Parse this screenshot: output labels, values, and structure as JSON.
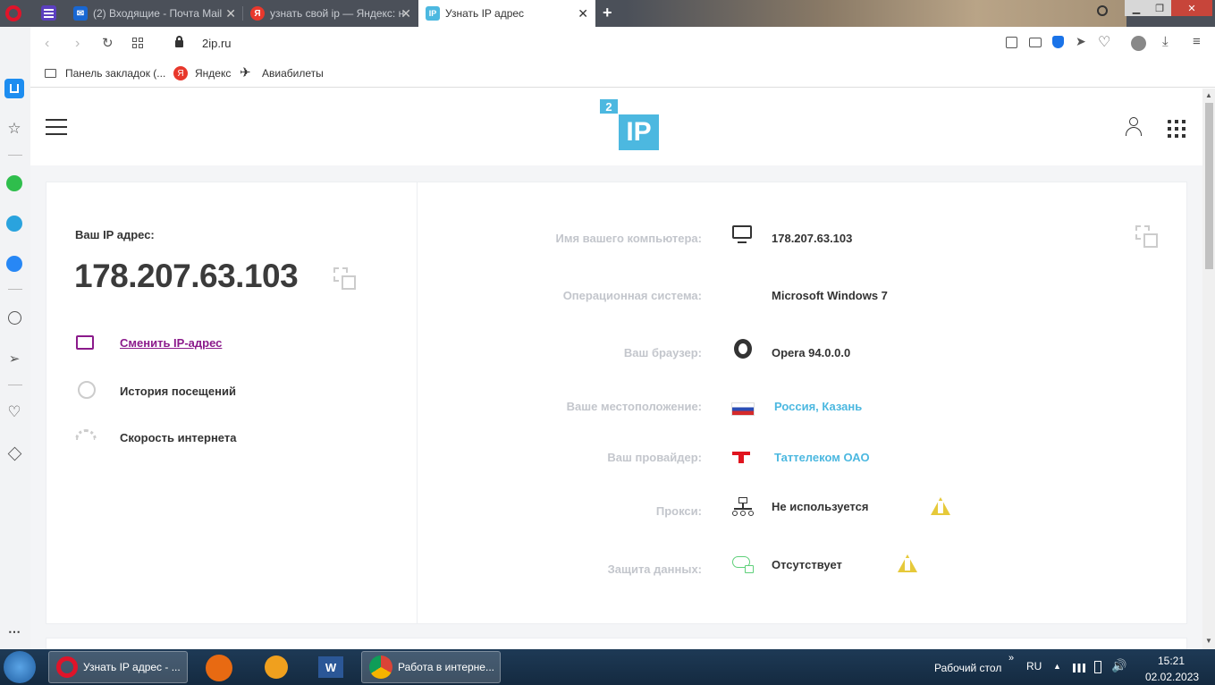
{
  "browser": {
    "tabs": [
      {
        "label": "(2) Входящие - Почта Mail",
        "favicon": "mail-icon"
      },
      {
        "label": "узнать свой ip — Яндекс: н",
        "favicon": "yandex-icon"
      },
      {
        "label": "Узнать IP адрес",
        "favicon": "2ip-icon"
      }
    ],
    "favicon_ip": "IP",
    "address": "2ip.ru",
    "bookmarks": {
      "folder": "Панель закладок (...",
      "yandex": "Яндекс",
      "avia": "Авиабилеты"
    }
  },
  "site": {
    "logo_num": "2",
    "logo_text": "IP",
    "your_ip_label": "Ваш IP адрес:",
    "ip": "178.207.63.103",
    "actions": [
      {
        "label": "Сменить IP-адрес"
      },
      {
        "label": "История посещений"
      },
      {
        "label": "Скорость интернета"
      }
    ],
    "info": [
      {
        "label": "Имя вашего компьютера:",
        "value": "178.207.63.103"
      },
      {
        "label": "Операционная система:",
        "value": "Microsoft Windows 7"
      },
      {
        "label": "Ваш браузер:",
        "value": "Opera 94.0.0.0"
      },
      {
        "label": "Ваше местоположение:",
        "value": "Россия, Казань"
      },
      {
        "label": "Ваш провайдер:",
        "value": "Таттелеком ОАО"
      },
      {
        "label": "Прокси:",
        "value": "Не используется"
      },
      {
        "label": "Защита данных:",
        "value": "Отсутствует"
      }
    ]
  },
  "taskbar": {
    "opera_task": "Узнать IP адрес - ...",
    "chrome_task": "Работа в интерне...",
    "desktop": "Рабочий стол",
    "lang": "RU",
    "time": "15:21",
    "date": "02.02.2023"
  },
  "colors": {
    "accent": "#4cb8e0",
    "purple": "#8b1a8b",
    "warning": "#e6c93a"
  }
}
